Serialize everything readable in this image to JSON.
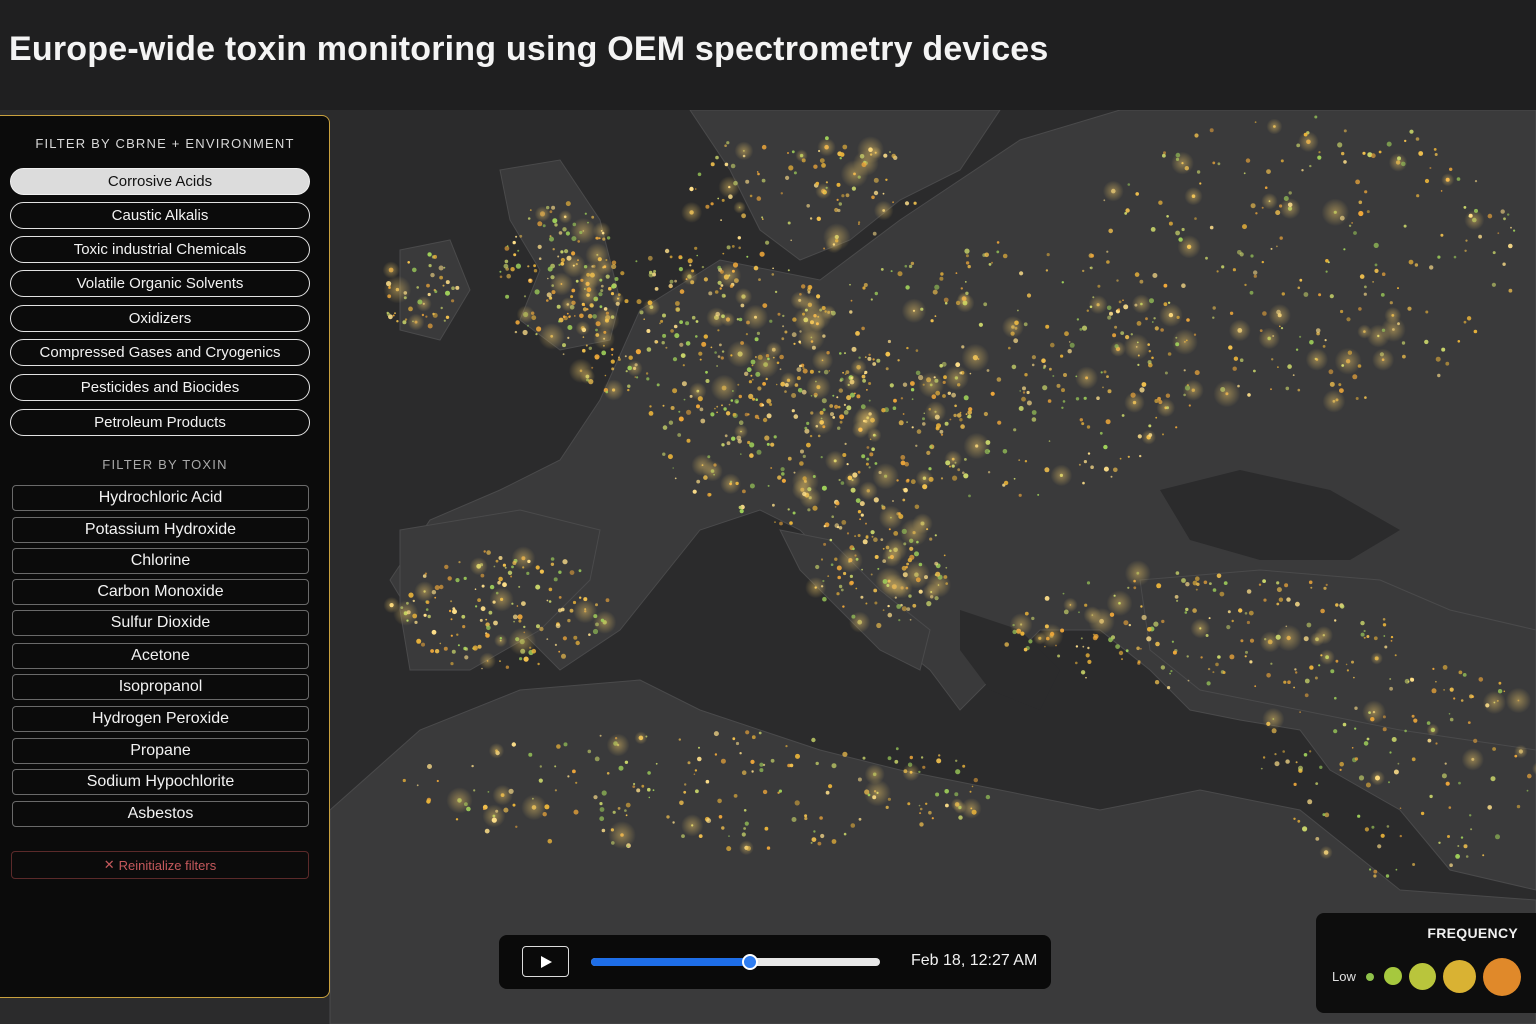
{
  "header": {
    "title": "Europe-wide toxin monitoring using OEM spectrometry devices"
  },
  "sidebar": {
    "category_title": "FILTER BY CBRNE + ENVIRONMENT",
    "categories": [
      {
        "label": "Corrosive Acids",
        "active": true
      },
      {
        "label": "Caustic Alkalis",
        "active": false
      },
      {
        "label": "Toxic industrial Chemicals",
        "active": false
      },
      {
        "label": "Volatile Organic Solvents",
        "active": false
      },
      {
        "label": "Oxidizers",
        "active": false
      },
      {
        "label": "Compressed Gases and Cryogenics",
        "active": false
      },
      {
        "label": "Pesticides and Biocides",
        "active": false
      },
      {
        "label": "Petroleum Products",
        "active": false
      }
    ],
    "toxin_title": "FILTER BY TOXIN",
    "toxins": [
      "Hydrochloric Acid",
      "Potassium Hydroxide",
      "Chlorine",
      "Carbon Monoxide",
      "Sulfur Dioxide",
      "Acetone",
      "Isopropanol",
      "Hydrogen Peroxide",
      "Propane",
      "Sodium Hypochlorite",
      "Asbestos"
    ],
    "reset_icon": "close-icon",
    "reset_label": "Reinitialize filters"
  },
  "playback": {
    "play_icon": "play-icon",
    "progress": 0.55,
    "timestamp": "Feb 18, 12:27 AM"
  },
  "legend": {
    "title": "FREQUENCY",
    "low_label": "Low",
    "levels": [
      {
        "color": "#8fc24a"
      },
      {
        "color": "#a6c83e"
      },
      {
        "color": "#b9c53c"
      },
      {
        "color": "#d9b233"
      },
      {
        "color": "#e0892a"
      }
    ]
  },
  "colors": {
    "accent_border": "#c9a13e",
    "active_filter": "#dcdcdc",
    "slider": "#1e6ee8",
    "reset": "#c5595c",
    "land": "#3a3a3b",
    "sea": "#2b2b2c"
  }
}
